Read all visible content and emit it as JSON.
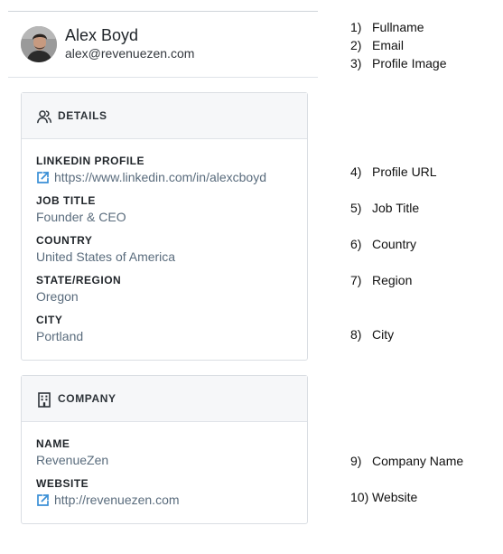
{
  "profile": {
    "full_name": "Alex Boyd",
    "email": "alex@revenuezen.com"
  },
  "details": {
    "title": "DETAILS",
    "fields": [
      {
        "label": "LINKEDIN PROFILE",
        "value": "https://www.linkedin.com/in/alexcboyd"
      },
      {
        "label": "JOB TITLE",
        "value": "Founder & CEO"
      },
      {
        "label": "COUNTRY",
        "value": "United States of America"
      },
      {
        "label": "STATE/REGION",
        "value": "Oregon"
      },
      {
        "label": "CITY",
        "value": "Portland"
      }
    ]
  },
  "company": {
    "title": "COMPANY",
    "fields": [
      {
        "label": "NAME",
        "value": "RevenueZen"
      },
      {
        "label": "WEBSITE",
        "value": "http://revenuezen.com"
      }
    ]
  },
  "legend": [
    {
      "num": "1)",
      "text": "Fullname"
    },
    {
      "num": "2)",
      "text": "Email"
    },
    {
      "num": "3)",
      "text": "Profile Image"
    },
    {
      "num": "4)",
      "text": "Profile URL"
    },
    {
      "num": "5)",
      "text": "Job Title"
    },
    {
      "num": "6)",
      "text": "Country"
    },
    {
      "num": "7)",
      "text": "Region"
    },
    {
      "num": "8)",
      "text": "City"
    },
    {
      "num": "9)",
      "text": "Company Name"
    },
    {
      "num": "10)",
      "text": "Website"
    }
  ],
  "colors": {
    "link_icon": "#3a8fd6",
    "value_text": "#5a6c7d",
    "card_header_bg": "#f6f7f9"
  },
  "icons": {
    "details": "person-group-icon",
    "company": "building-icon",
    "link": "external-link-icon"
  }
}
